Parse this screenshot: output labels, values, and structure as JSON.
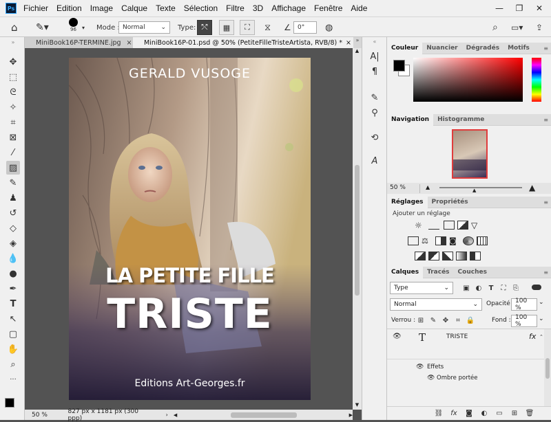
{
  "menu": {
    "logo": "Ps",
    "items": [
      "Fichier",
      "Edition",
      "Image",
      "Calque",
      "Texte",
      "Sélection",
      "Filtre",
      "3D",
      "Affichage",
      "Fenêtre",
      "Aide"
    ]
  },
  "options": {
    "brush_size": "96",
    "mode_label": "Mode :",
    "mode_value": "Normal",
    "type_label": "Type:",
    "angle_value": "0°"
  },
  "tabs": [
    {
      "label": "MiniBook16P-TERMINE.jpg",
      "active": false
    },
    {
      "label": "MiniBook16P-01.psd @ 50% (PetiteFilleTristeArtista, RVB/8) *",
      "active": true
    }
  ],
  "document": {
    "author": "GERALD VUSOGE",
    "title_line1": "LA PETITE FILLE",
    "title_line2": "TRISTE",
    "publisher": "Editions Art-Georges.fr"
  },
  "status": {
    "zoom": "50 %",
    "dimensions": "827 px x 1181 px (300 ppp)"
  },
  "color_panel": {
    "tabs": [
      "Couleur",
      "Nuancier",
      "Dégradés",
      "Motifs"
    ],
    "foreground": "#000000",
    "background": "#ffffff"
  },
  "navigation_panel": {
    "tabs": [
      "Navigation",
      "Histogramme"
    ],
    "zoom": "50 %"
  },
  "adjustments_panel": {
    "tabs": [
      "Réglages",
      "Propriétés"
    ],
    "add_label": "Ajouter un réglage"
  },
  "layers_panel": {
    "tabs": [
      "Calques",
      "Tracés",
      "Couches"
    ],
    "filter_value": "Type",
    "blend_mode": "Normal",
    "opacity_label": "Opacité :",
    "opacity_value": "100 %",
    "lock_label": "Verrou :",
    "fill_label": "Fond :",
    "fill_value": "100 %",
    "layer_name": "TRISTE",
    "fx_label": "fx",
    "effects_label": "Effets",
    "effect_item": "Ombre portée"
  },
  "colors": {
    "accent": "#31a8ff",
    "chrome": "#f0f0f0",
    "workspace": "#535353"
  }
}
